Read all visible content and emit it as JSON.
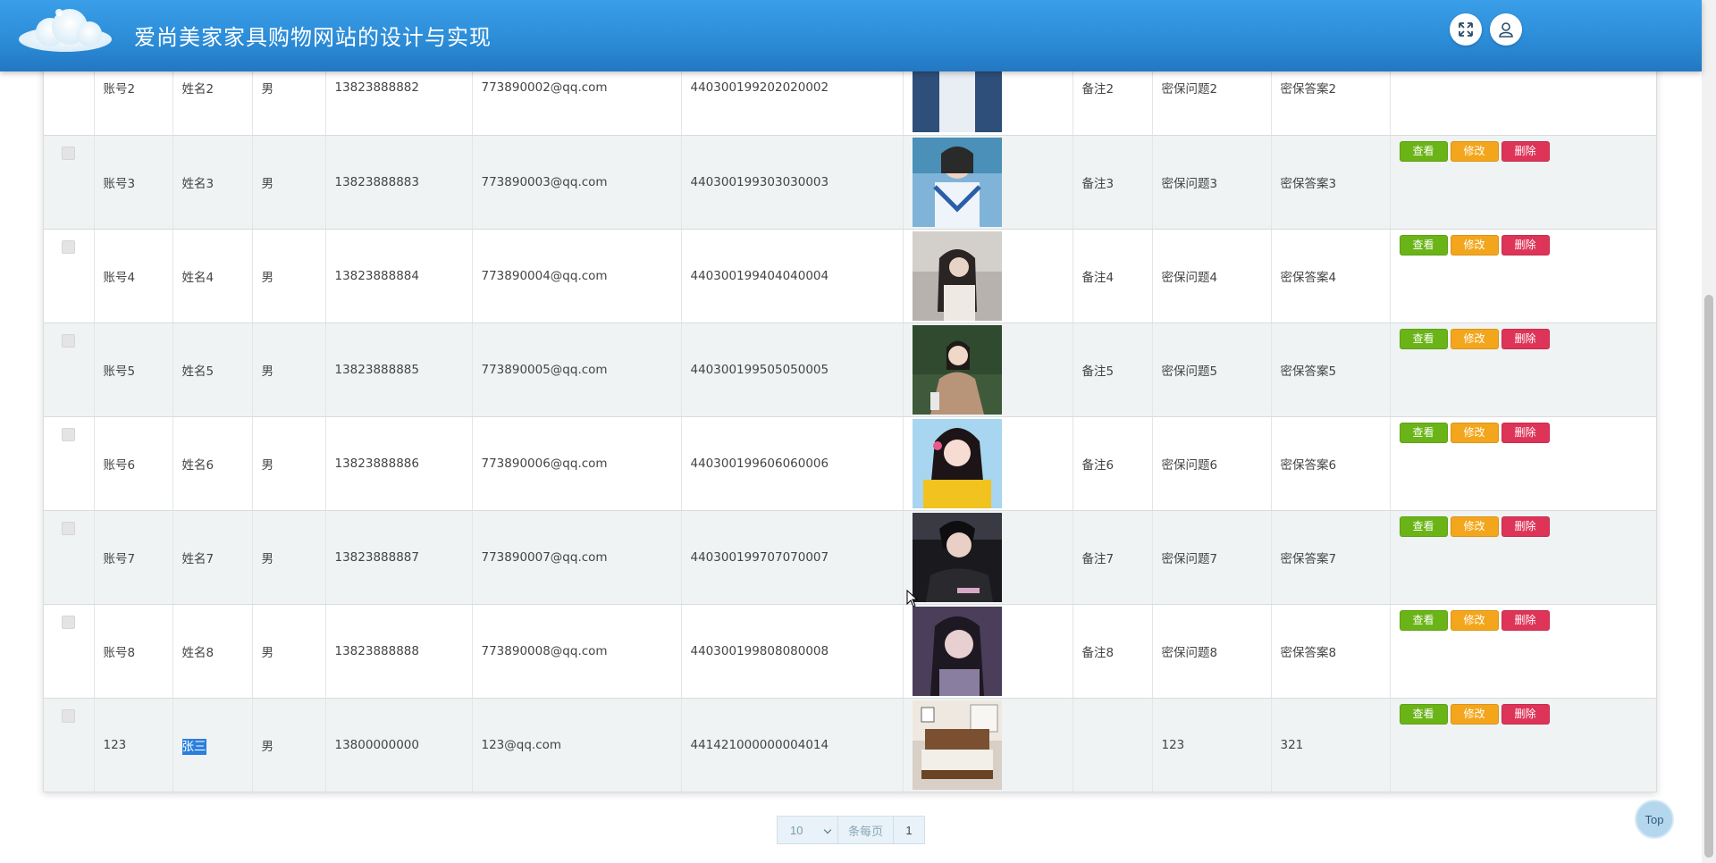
{
  "header": {
    "title": "爱尚美家家具购物网站的设计与实现",
    "fullscreen_icon": "expand-icon",
    "user_icon": "user-icon"
  },
  "colors": {
    "header": "#2b8bd6",
    "view": "#6ab418",
    "edit": "#f3a61c",
    "delete": "#dd3458"
  },
  "actions": {
    "view": "查看",
    "edit": "修改",
    "delete": "删除"
  },
  "rows": [
    {
      "account": "账号2",
      "name": "姓名2",
      "gender": "男",
      "phone": "13823888882",
      "email": "773890002@qq.com",
      "id_card": "440300199202020002",
      "photo": "photo-boy",
      "note": "备注2",
      "question": "密保问题2",
      "answer": "密保答案2"
    },
    {
      "account": "账号3",
      "name": "姓名3",
      "gender": "男",
      "phone": "13823888883",
      "email": "773890003@qq.com",
      "id_card": "440300199303030003",
      "photo": "photo-girl-uniform",
      "note": "备注3",
      "question": "密保问题3",
      "answer": "密保答案3"
    },
    {
      "account": "账号4",
      "name": "姓名4",
      "gender": "男",
      "phone": "13823888884",
      "email": "773890004@qq.com",
      "id_card": "440300199404040004",
      "photo": "photo-girl-gray",
      "note": "备注4",
      "question": "密保问题4",
      "answer": "密保答案4"
    },
    {
      "account": "账号5",
      "name": "姓名5",
      "gender": "男",
      "phone": "13823888885",
      "email": "773890005@qq.com",
      "id_card": "440300199505050005",
      "photo": "photo-girl-forest",
      "note": "备注5",
      "question": "密保问题5",
      "answer": "密保答案5"
    },
    {
      "account": "账号6",
      "name": "姓名6",
      "gender": "男",
      "phone": "13823888886",
      "email": "773890006@qq.com",
      "id_card": "440300199606060006",
      "photo": "photo-girl-yellow",
      "note": "备注6",
      "question": "密保问题6",
      "answer": "密保答案6"
    },
    {
      "account": "账号7",
      "name": "姓名7",
      "gender": "男",
      "phone": "13823888887",
      "email": "773890007@qq.com",
      "id_card": "440300199707070007",
      "photo": "photo-girl-dark",
      "note": "备注7",
      "question": "密保问题7",
      "answer": "密保答案7"
    },
    {
      "account": "账号8",
      "name": "姓名8",
      "gender": "男",
      "phone": "13823888888",
      "email": "773890008@qq.com",
      "id_card": "440300199808080008",
      "photo": "photo-girl-purple",
      "note": "备注8",
      "question": "密保问题8",
      "answer": "密保答案8"
    },
    {
      "account": "123",
      "name": "张三",
      "gender": "男",
      "phone": "13800000000",
      "email": "123@qq.com",
      "id_card": "441421000000004014",
      "photo": "photo-bed",
      "note": "",
      "question": "123",
      "answer": "321"
    }
  ],
  "pagination": {
    "page_size": "10",
    "per_page_label": "条每页",
    "current_page": "1"
  },
  "top_button": "Top"
}
